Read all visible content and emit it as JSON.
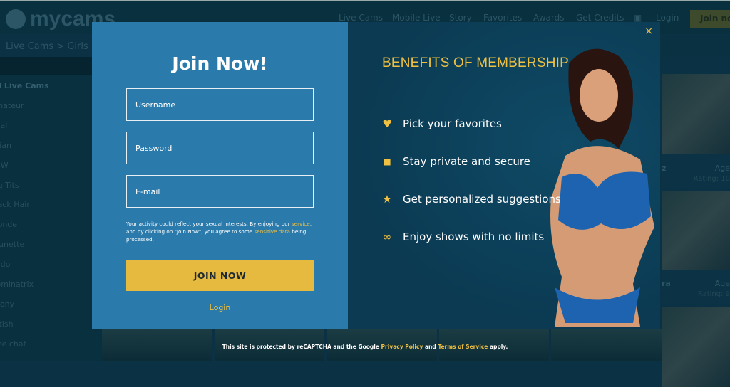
{
  "header": {
    "logo": "mycams",
    "nav": [
      "Live Cams",
      "Mobile Live",
      "Story",
      "Favorites",
      "Awards",
      "Get Credits"
    ],
    "login": "Login",
    "join": "Join now"
  },
  "breadcrumb": "Live Cams > Girls",
  "sidebar": {
    "items": [
      "All Live Cams",
      "Amateur",
      "Anal",
      "Asian",
      "BBW",
      "Big Tits",
      "Black Hair",
      "Blonde",
      "Brunette",
      "Dildo",
      "Dominatrix",
      "Ebony",
      "Fetish",
      "Free chat"
    ]
  },
  "tiles": [
    {
      "name": "z",
      "age": "Age",
      "rating": "Rating: 10"
    },
    {
      "name": "ra",
      "age": "Age",
      "rating": "Rating: 9"
    }
  ],
  "modal": {
    "title": "Join Now!",
    "username_placeholder": "Username",
    "password_placeholder": "Password",
    "email_placeholder": "E-mail",
    "legal_1": "Your activity could reflect your sexual interests. By enjoying our ",
    "legal_service": "service",
    "legal_2": ", and by clicking on \"Join Now\", you agree to some ",
    "legal_sensitive": "sensitive data",
    "legal_3": " being processed.",
    "submit": "JOIN NOW",
    "login": "Login",
    "close": "×",
    "benefits_title": "BENEFITS OF MEMBERSHIP",
    "benefits": [
      {
        "icon": "heart-icon",
        "glyph": "♥",
        "text": "Pick your favorites"
      },
      {
        "icon": "lock-icon",
        "glyph": "🔒",
        "text": "Stay private and secure"
      },
      {
        "icon": "star-icon",
        "glyph": "★",
        "text": "Get personalized suggestions"
      },
      {
        "icon": "infinity-icon",
        "glyph": "∞",
        "text": "Enjoy shows with no limits"
      }
    ]
  },
  "footer": {
    "t1": "This site is protected by reCAPTCHA and the Google ",
    "privacy": "Privacy Policy",
    "t2": " and ",
    "terms": "Terms of Service",
    "t3": " apply."
  },
  "colors": {
    "accent": "#f0c040",
    "left_panel": "#2a7aab",
    "right_panel": "#0b3a52"
  }
}
